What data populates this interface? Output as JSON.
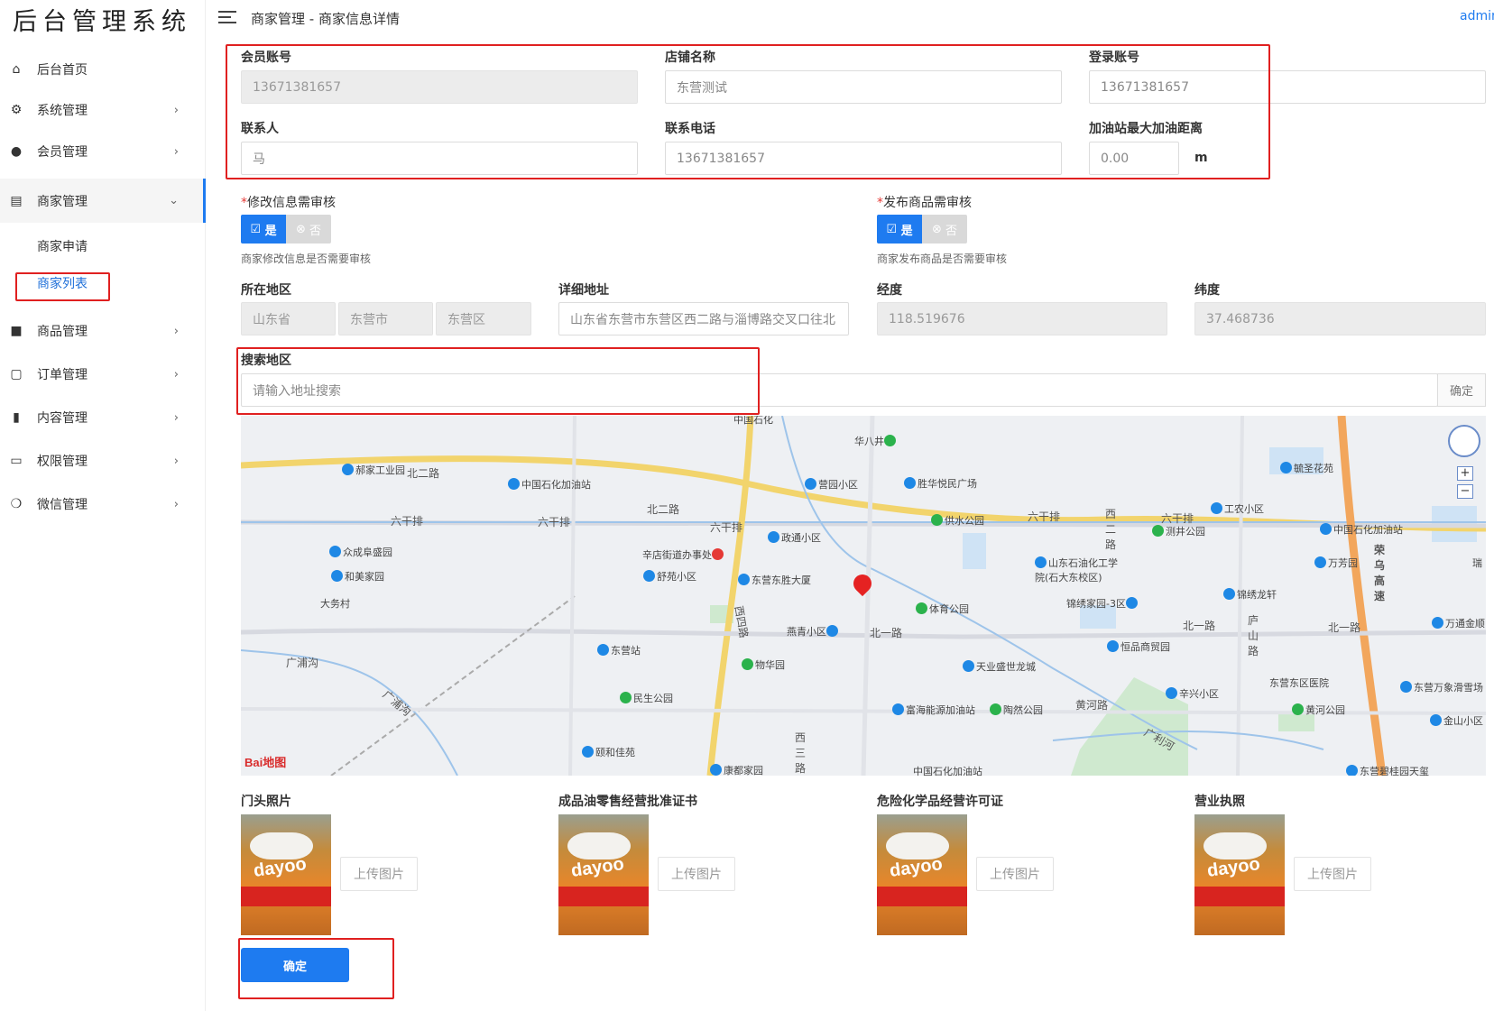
{
  "app_title": "后台管理系统",
  "sidebar": {
    "items": [
      {
        "label": "后台首页",
        "icon": "home-icon"
      },
      {
        "label": "系统管理",
        "icon": "gear-icon"
      },
      {
        "label": "会员管理",
        "icon": "users-icon"
      },
      {
        "label": "商家管理",
        "icon": "store-icon"
      },
      {
        "label": "商品管理",
        "icon": "bag-icon"
      },
      {
        "label": "订单管理",
        "icon": "clipboard-icon"
      },
      {
        "label": "内容管理",
        "icon": "document-icon"
      },
      {
        "label": "权限管理",
        "icon": "laptop-icon"
      },
      {
        "label": "微信管理",
        "icon": "wechat-icon"
      }
    ],
    "sub_items": [
      {
        "label": "商家申请"
      },
      {
        "label": "商家列表",
        "selected": true
      }
    ]
  },
  "header": {
    "breadcrumb": "商家管理 - 商家信息详情",
    "user": "admin"
  },
  "form": {
    "member_account": {
      "label": "会员账号",
      "value": "13671381657"
    },
    "store_name": {
      "label": "店铺名称",
      "value": "东营测试"
    },
    "login_account": {
      "label": "登录账号",
      "value": "13671381657"
    },
    "contact": {
      "label": "联系人",
      "value": "马"
    },
    "contact_phone": {
      "label": "联系电话",
      "value": "13671381657"
    },
    "max_distance": {
      "label": "加油站最大加油距离",
      "value": "0.00",
      "unit": "m"
    },
    "edit_review": {
      "label": "修改信息需审核",
      "yes": "是",
      "no": "否",
      "selected": "是",
      "hint": "商家修改信息是否需要审核"
    },
    "goods_review": {
      "label": "发布商品需审核",
      "yes": "是",
      "no": "否",
      "selected": "是",
      "hint": "商家发布商品是否需要审核"
    },
    "region": {
      "label": "所在地区",
      "province": "山东省",
      "city": "东营市",
      "district": "东营区"
    },
    "address": {
      "label": "详细地址",
      "value": "山东省东营市东营区西二路与淄博路交叉口往北"
    },
    "longitude": {
      "label": "经度",
      "value": "118.519676"
    },
    "latitude": {
      "label": "纬度",
      "value": "37.468736"
    },
    "search_region": {
      "label": "搜索地区",
      "placeholder": "请输入地址搜索",
      "button": "确定"
    },
    "photos": [
      {
        "label": "门头照片",
        "upload": "上传图片"
      },
      {
        "label": "成品油零售经营批准证书",
        "upload": "上传图片"
      },
      {
        "label": "危险化学品经营许可证",
        "upload": "上传图片"
      },
      {
        "label": "营业执照",
        "upload": "上传图片"
      }
    ],
    "photo_brand": "dayoo",
    "submit": "确定"
  },
  "map": {
    "roads": [
      "北二路",
      "北二路",
      "六干排",
      "六干排",
      "六干排",
      "六干排",
      "六干排",
      "西四路",
      "北一路",
      "北一路",
      "北一路",
      "广浦沟",
      "广浦沟",
      "黄河路",
      "广利河",
      "西二路",
      "西三路",
      "庐山路",
      "荣乌高速",
      "中国石化"
    ],
    "pois": [
      "郝家工业园",
      "中国石化加油站",
      "华八井",
      "营园小区",
      "胜华悦民广场",
      "供水公园",
      "测井公园",
      "工农小区",
      "毓圣花苑",
      "中国石化加油站",
      "众成阜盛园",
      "和美家园",
      "大务村",
      "辛店街道办事处",
      "政通小区",
      "舒苑小区",
      "东营东胜大厦",
      "山东石油化工学院(石大东校区)",
      "万芳园",
      "锦绣家园-3区",
      "锦绣龙轩",
      "体育公园",
      "燕青小区",
      "东营站",
      "物华园",
      "天业盛世龙城",
      "恒品商贸园",
      "万通金顺",
      "东营东区医院",
      "东营万象滑雪场",
      "民生公园",
      "富海能源加油站",
      "陶然公园",
      "辛兴小区",
      "黄河公园",
      "金山小区",
      "颐和佳苑",
      "康都家园",
      "中国石化加油站",
      "东营碧桂园天玺",
      "瑞"
    ],
    "attribution": "Bai地图"
  },
  "colors": {
    "accent": "#1e7bf0",
    "highlight": "#e02020"
  }
}
